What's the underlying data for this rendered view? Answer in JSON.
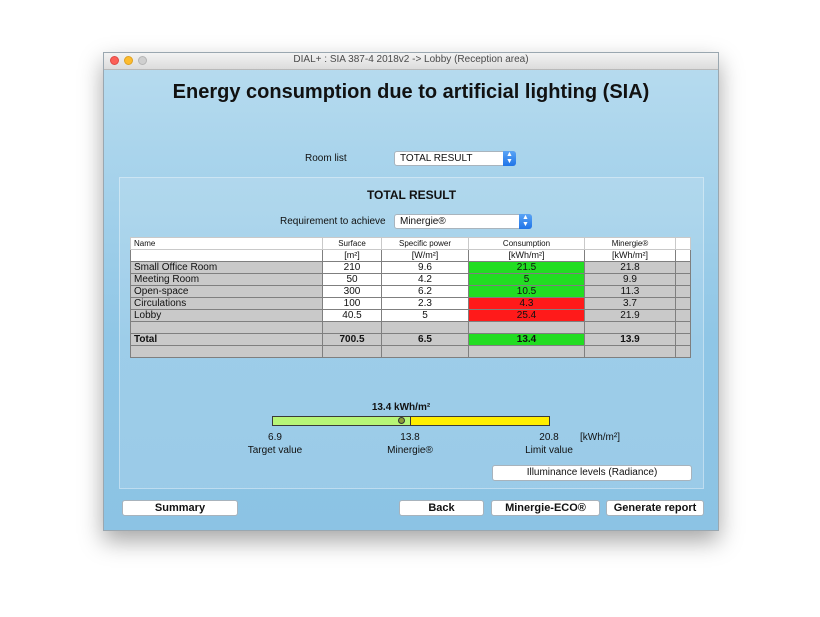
{
  "window": {
    "title": "DIAL+ : SIA 387-4 2018v2 -> Lobby (Reception area)"
  },
  "heading": "Energy consumption due to artificial lighting (SIA)",
  "room_list": {
    "label": "Room list",
    "selected": "TOTAL RESULT"
  },
  "panel": {
    "title": "TOTAL RESULT",
    "requirement_label": "Requirement to achieve",
    "requirement_selected": "Minergie®"
  },
  "table": {
    "headers": [
      "Name",
      "Surface",
      "Specific power",
      "Consumption",
      "Minergie®"
    ],
    "units": [
      "",
      "[m²]",
      "[W/m²]",
      "[kWh/m²]",
      "[kWh/m²]"
    ],
    "rows": [
      {
        "name": "Small Office Room",
        "surface": "210",
        "power": "9.6",
        "consumption": "21.5",
        "minergie": "21.8",
        "status": "ok"
      },
      {
        "name": "Meeting Room",
        "surface": "50",
        "power": "4.2",
        "consumption": "5",
        "minergie": "9.9",
        "status": "ok"
      },
      {
        "name": "Open-space",
        "surface": "300",
        "power": "6.2",
        "consumption": "10.5",
        "minergie": "11.3",
        "status": "ok"
      },
      {
        "name": "Circulations",
        "surface": "100",
        "power": "2.3",
        "consumption": "4.3",
        "minergie": "3.7",
        "status": "bad"
      },
      {
        "name": "Lobby",
        "surface": "40.5",
        "power": "5",
        "consumption": "25.4",
        "minergie": "21.9",
        "status": "bad"
      }
    ],
    "total": {
      "name": "Total",
      "surface": "700.5",
      "power": "6.5",
      "consumption": "13.4",
      "minergie": "13.9",
      "status": "ok"
    }
  },
  "gauge": {
    "value_label": "13.4 kWh/m²",
    "value": 13.4,
    "target_value": "6.9",
    "minergie_value": "13.8",
    "limit_value": "20.8",
    "unit": "[kWh/m²]",
    "target_caption": "Target value",
    "minergie_caption": "Minergie®",
    "limit_caption": "Limit value"
  },
  "buttons": {
    "illuminance": "Illuminance levels (Radiance)",
    "summary": "Summary",
    "back": "Back",
    "minergie_eco": "Minergie-ECO®",
    "generate_report": "Generate report"
  },
  "colors": {
    "ok": "#22dd22",
    "bad": "#ff1a1a",
    "gauge_green": "#b7f577",
    "gauge_yellow": "#ffee00"
  }
}
